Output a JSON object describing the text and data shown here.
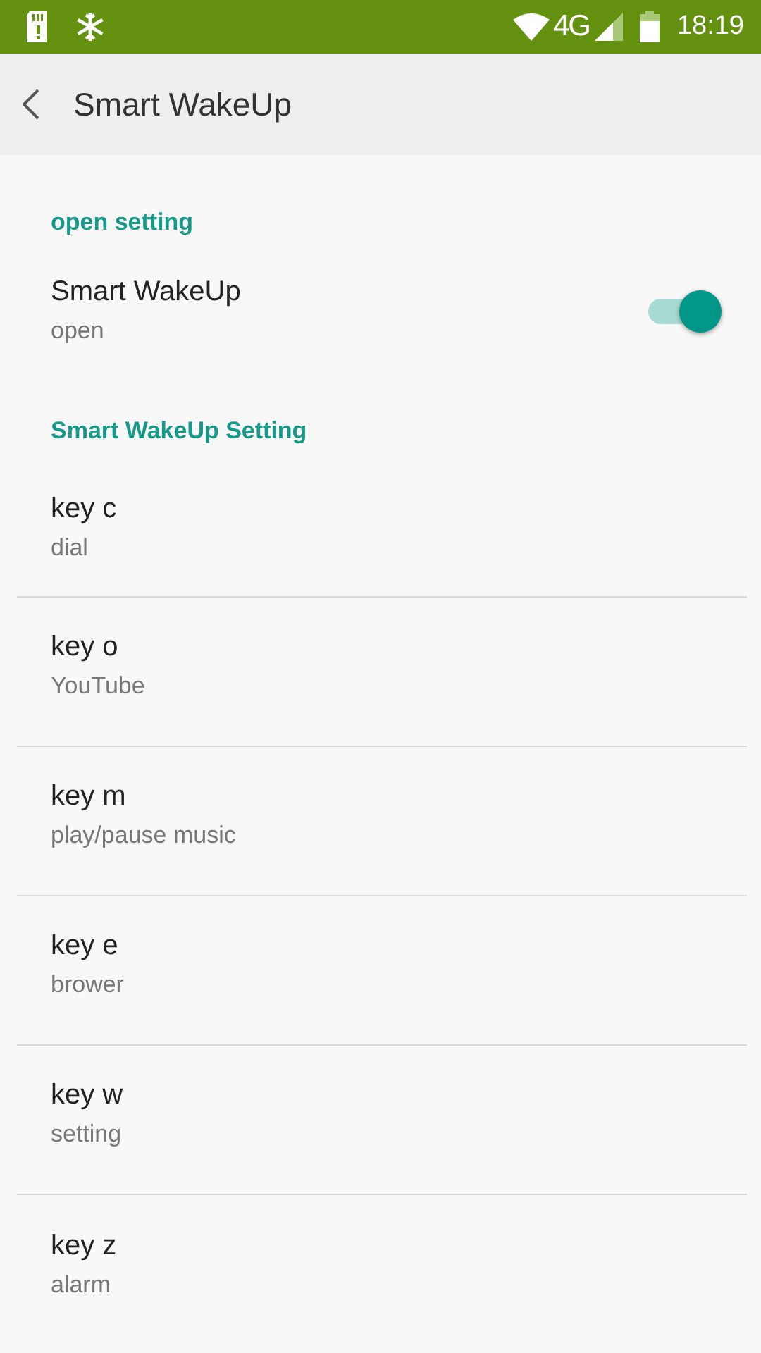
{
  "status_bar": {
    "time": "18:19",
    "network": "4G"
  },
  "toolbar": {
    "title": "Smart WakeUp"
  },
  "sections": [
    {
      "header": "open setting",
      "items": [
        {
          "kind": "switch",
          "title": "Smart WakeUp",
          "summary": "open",
          "on": true
        }
      ]
    },
    {
      "header": "Smart WakeUp Setting",
      "items": [
        {
          "kind": "plain",
          "title": "key c",
          "summary": "dial"
        },
        {
          "kind": "plain",
          "title": "key o",
          "summary": "YouTube"
        },
        {
          "kind": "plain",
          "title": "key m",
          "summary": "play/pause music"
        },
        {
          "kind": "plain",
          "title": "key e",
          "summary": "brower"
        },
        {
          "kind": "plain",
          "title": "key w",
          "summary": "setting"
        },
        {
          "kind": "plain",
          "title": "key z",
          "summary": "alarm"
        }
      ]
    }
  ]
}
